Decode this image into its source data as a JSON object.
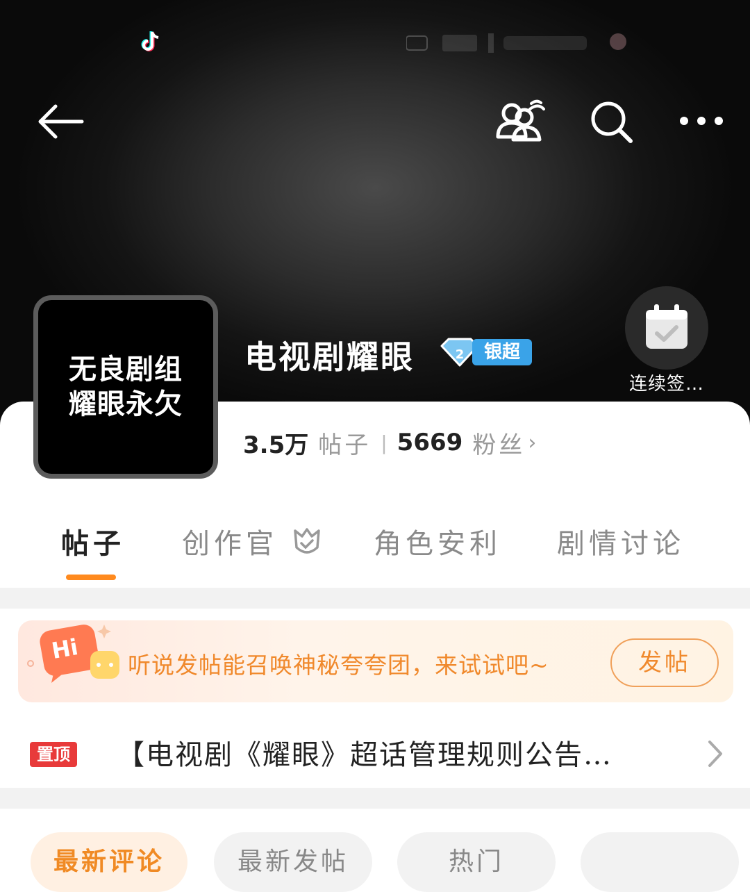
{
  "topic": {
    "avatar_line1": "无良剧组",
    "avatar_line2": "耀眼永欠",
    "title": "电视剧耀眼",
    "level_badge": "银超",
    "signin_label": "连续签…"
  },
  "stats": {
    "posts_count": "3.5万",
    "posts_label": "帖子",
    "fans_count": "5669",
    "fans_label": "粉丝"
  },
  "tabs": [
    {
      "label": "帖子"
    },
    {
      "label": "创作官"
    },
    {
      "label": "角色安利"
    },
    {
      "label": "剧情讨论"
    }
  ],
  "promo": {
    "text": "听说发帖能召唤神秘夸夸团，来试试吧~",
    "button": "发帖",
    "bubble_text": "Hi"
  },
  "pinned": {
    "badge": "置顶",
    "text": "【电视剧《耀眼》超话管理规则公告…"
  },
  "filters": [
    {
      "label": "最新评论"
    },
    {
      "label": "最新发帖"
    },
    {
      "label": "热门"
    },
    {
      "label": ""
    }
  ],
  "colors": {
    "accent": "#ff8a1e",
    "promo_text": "#f0892c",
    "pinned_badge": "#e83a3a",
    "level_badge": "#3aa3e8"
  },
  "icons": {
    "back": "arrow-left-icon",
    "group": "user-group-icon",
    "search": "search-icon",
    "more": "more-dots-icon",
    "signin": "calendar-check-icon",
    "creator": "creator-badge-icon",
    "chevron": "chevron-right-icon"
  }
}
